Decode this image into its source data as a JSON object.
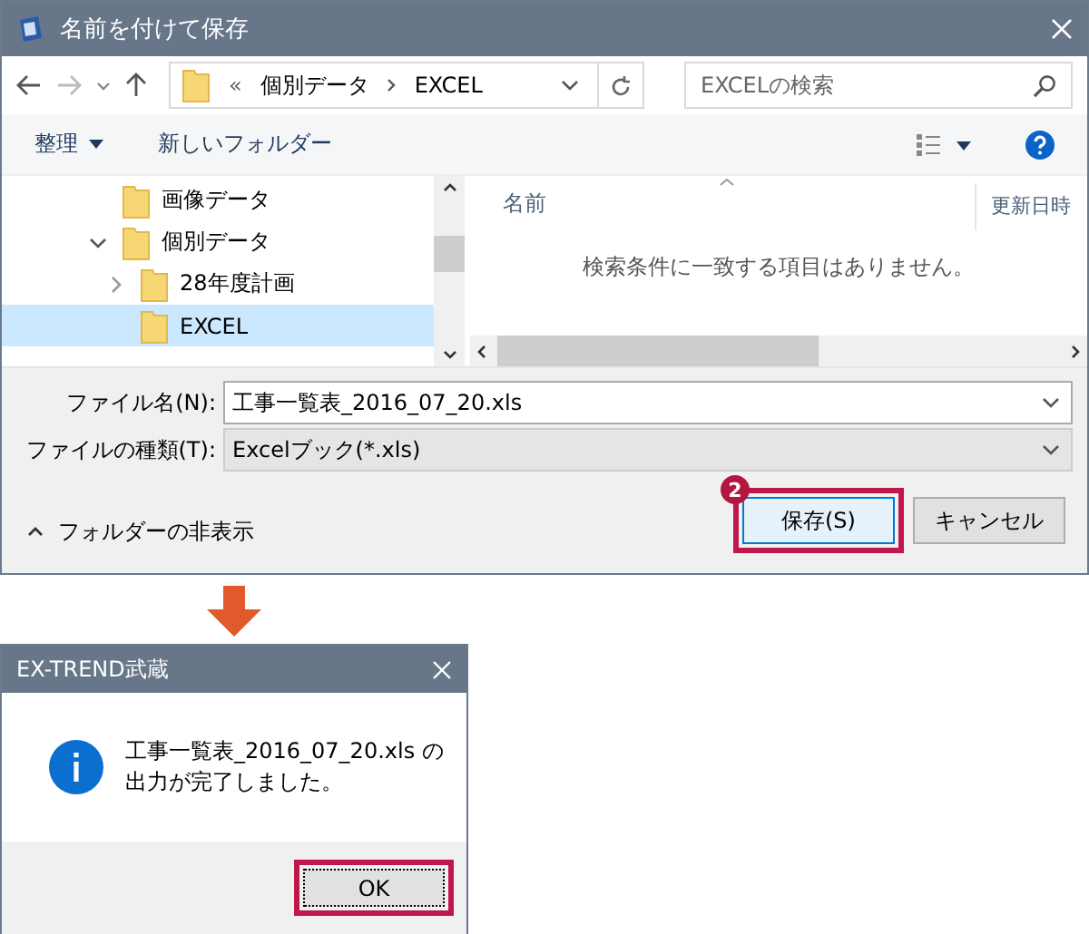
{
  "save_dialog": {
    "title": "名前を付けて保存",
    "address": {
      "overflow": "«",
      "crumbs": [
        "個別データ",
        "EXCEL"
      ]
    },
    "search": {
      "placeholder": "EXCELの検索"
    },
    "toolbar": {
      "organize": "整理",
      "new_folder": "新しいフォルダー"
    },
    "tree": [
      {
        "label": "画像データ",
        "selected": false
      },
      {
        "label": "個別データ",
        "selected": false,
        "expanded": true,
        "children": [
          {
            "label": "28年度計画",
            "selected": false,
            "expanded": false
          },
          {
            "label": "EXCEL",
            "selected": true
          }
        ]
      }
    ],
    "columns": [
      "名前",
      "更新日時"
    ],
    "empty_message": "検索条件に一致する項目はありません。",
    "file_name": {
      "label": "ファイル名(N):",
      "value": "工事一覧表_2016_07_20.xls"
    },
    "file_type": {
      "label": "ファイルの種類(T):",
      "value": "Excelブック(*.xls)"
    },
    "hide_folders": "フォルダーの非表示",
    "step_badge": "2",
    "buttons": [
      {
        "label": "保存(S)",
        "highlighted": true
      },
      {
        "label": "キャンセル",
        "highlighted": false
      }
    ]
  },
  "message_box": {
    "title": "EX-TREND武蔵",
    "message_lines": [
      "工事一覧表_2016_07_20.xls の",
      "出力が完了しました。"
    ],
    "button": {
      "label": "OK",
      "highlighted": true
    }
  }
}
